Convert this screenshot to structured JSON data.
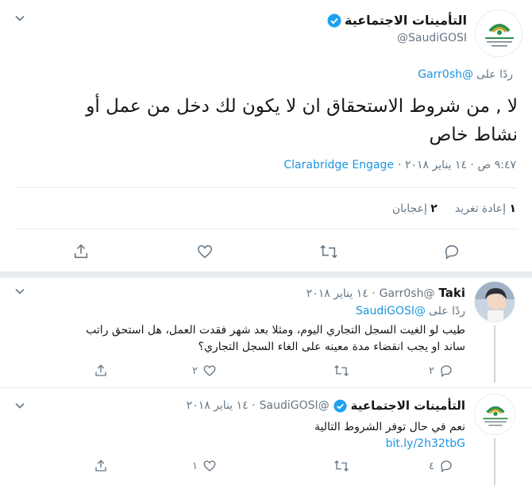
{
  "main_tweet": {
    "display_name": "التأمينات الاجتماعية",
    "handle": "@SaudiGOSI",
    "replying_prefix": "ردًا على",
    "replying_to": "@Garr0sh",
    "text_line1": "لا , من شروط الاستحقاق ان لا يكون لك دخل من عمل أو",
    "text_line2": "نشاط خاص",
    "timestamp": "٩:٤٧ ص · ١٤ يناير ٢٠١٨ ·",
    "source": "Clarabridge Engage",
    "retweets_count": "١",
    "retweets_label": "إعادة تغريد",
    "likes_count": "٢",
    "likes_label": "إعجابان"
  },
  "reply1": {
    "display_name": "Taki",
    "handle": "@Garr0sh",
    "date": "· ١٤ يناير ٢٠١٨",
    "replying_prefix": "ردًا على",
    "replying_to": "@SaudiGOSI",
    "text_line1": "طيب لو الغيت السجل التجاري اليوم، ومثلا بعد شهر فقدت العمل، هل استحق راتب",
    "text_line2": "ساند او يجب انقضاء مدة معينه على الغاء السجل التجاري؟",
    "reply_count": "٢",
    "retweet_count": "",
    "like_count": "٢"
  },
  "reply2": {
    "display_name": "التأمينات الاجتماعية",
    "handle": "@SaudiGOSI",
    "date": "· ١٤ يناير ٢٠١٨",
    "text_line1": "نعم في حال توفر الشروط التالية",
    "link": "bit.ly/2h32tbG",
    "reply_count": "٤",
    "retweet_count": "",
    "like_count": "١"
  },
  "colors": {
    "accent": "#1b95e0",
    "muted": "#657786",
    "verified": "#1da1f2",
    "divider": "#e6ecf0"
  },
  "icons": [
    "chevron-down-icon",
    "verified-badge-icon",
    "reply-icon",
    "retweet-icon",
    "like-icon",
    "share-icon"
  ]
}
